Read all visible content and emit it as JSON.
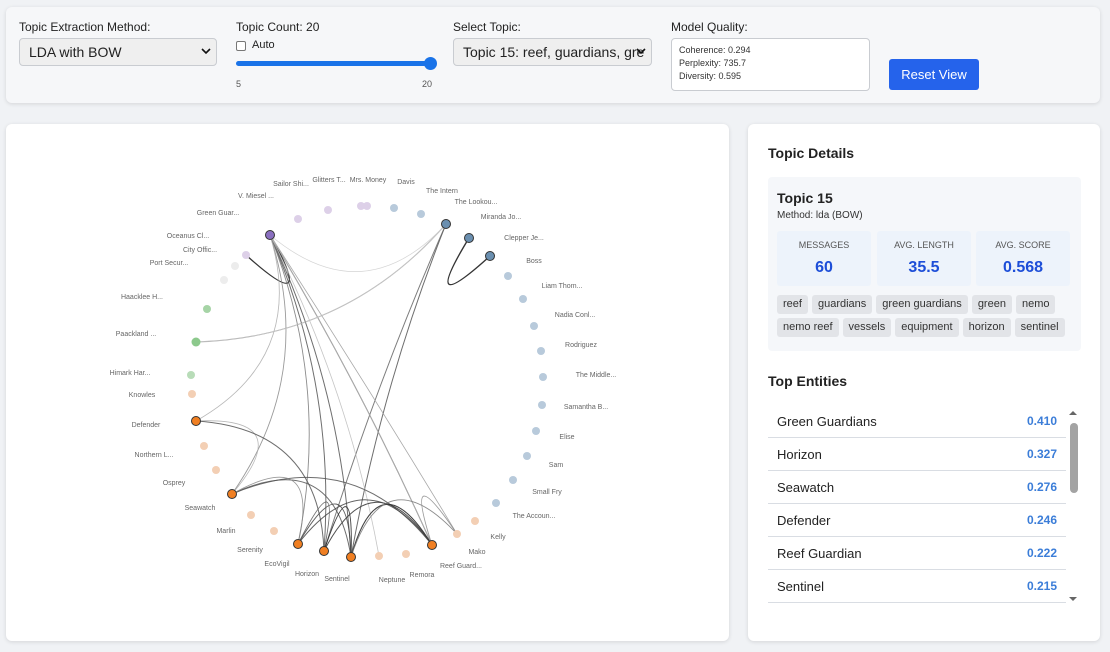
{
  "controls": {
    "method_label": "Topic Extraction Method:",
    "method_value": "LDA with BOW",
    "count_label": "Topic Count: 20",
    "auto_label": "Auto",
    "slider_min": "5",
    "slider_max": "20",
    "slider_fraction": 1.0,
    "topic_label": "Select Topic:",
    "topic_value": "Topic 15: reef, guardians, gre",
    "quality_label": "Model Quality:",
    "quality_lines": [
      "Coherence: 0.294",
      "Perplexity: 735.7",
      "Diversity: 0.595"
    ],
    "reset_label": "Reset View"
  },
  "graph": {
    "nodes": [
      {
        "label": "Davis",
        "color": "#b8cadb"
      },
      {
        "label": "The Intern",
        "color": "#b8cadb"
      },
      {
        "label": "The Lookou...",
        "color": "#6a8fb0"
      },
      {
        "label": "Miranda Jo...",
        "color": "#6a8fb0"
      },
      {
        "label": "Clepper Je...",
        "color": "#6a8fb0"
      },
      {
        "label": "Boss",
        "color": "#b8cadb"
      },
      {
        "label": "Liam Thom...",
        "color": "#b8cadb"
      },
      {
        "label": "Nadia Conl...",
        "color": "#b8cadb"
      },
      {
        "label": "Rodriguez",
        "color": "#b8cadb"
      },
      {
        "label": "The Middle...",
        "color": "#b8cadb"
      },
      {
        "label": "Samantha B...",
        "color": "#b8cadb"
      },
      {
        "label": "Elise",
        "color": "#b8cadb"
      },
      {
        "label": "Sam",
        "color": "#b8cadb"
      },
      {
        "label": "Small Fry",
        "color": "#b8cadb"
      },
      {
        "label": "The Accoun...",
        "color": "#b8cadb"
      },
      {
        "label": "Kelly",
        "color": "#f3cfb4"
      },
      {
        "label": "Mako",
        "color": "#f3cfb4"
      },
      {
        "label": "Reef Guard...",
        "color": "#f07f22"
      },
      {
        "label": "Remora",
        "color": "#f3cfb4"
      },
      {
        "label": "Neptune",
        "color": "#f3cfb4"
      },
      {
        "label": "Sentinel",
        "color": "#f07f22"
      },
      {
        "label": "Horizon",
        "color": "#f07f22"
      },
      {
        "label": "EcoVigil",
        "color": "#f07f22"
      },
      {
        "label": "Serenity",
        "color": "#f3cfb4"
      },
      {
        "label": "Marlin",
        "color": "#f3cfb4"
      },
      {
        "label": "Seawatch",
        "color": "#f07f22"
      },
      {
        "label": "Osprey",
        "color": "#f3cfb4"
      },
      {
        "label": "Northern L...",
        "color": "#f3cfb4"
      },
      {
        "label": "Defender",
        "color": "#f07f22"
      },
      {
        "label": "Knowles",
        "color": "#f3cfb4"
      },
      {
        "label": "Himark Har...",
        "color": "#b8dcb8"
      },
      {
        "label": "Paackland ...",
        "color": "#8cc98c"
      },
      {
        "label": "Haacklee H...",
        "color": "#a6d4a6"
      },
      {
        "label": "Port Secur...",
        "color": "#ededed"
      },
      {
        "label": "City Offic...",
        "color": "#ececec"
      },
      {
        "label": "Oceanus Cl...",
        "color": "#ddd0e8"
      },
      {
        "label": "Green Guar...",
        "color": "#8a6fc0"
      },
      {
        "label": "V. Miesel ...",
        "color": "#ddd0e8"
      },
      {
        "label": "Sailor Shi...",
        "color": "#ddd0e8"
      },
      {
        "label": "Glitters T...",
        "color": "#ddd0e8"
      },
      {
        "label": "Mrs. Money",
        "color": "#ddd0e8"
      }
    ]
  },
  "topic": {
    "details_title": "Topic Details",
    "name": "Topic 15",
    "method": "Method: lda (BOW)",
    "stats": [
      {
        "label": "MESSAGES",
        "value": "60"
      },
      {
        "label": "AVG. LENGTH",
        "value": "35.5"
      },
      {
        "label": "AVG. SCORE",
        "value": "0.568"
      }
    ],
    "keywords": [
      "reef",
      "guardians",
      "green guardians",
      "green",
      "nemo",
      "nemo reef",
      "vessels",
      "equipment",
      "horizon",
      "sentinel"
    ]
  },
  "entities": {
    "title": "Top Entities",
    "items": [
      {
        "name": "Green Guardians",
        "score": "0.410"
      },
      {
        "name": "Horizon",
        "score": "0.327"
      },
      {
        "name": "Seawatch",
        "score": "0.276"
      },
      {
        "name": "Defender",
        "score": "0.246"
      },
      {
        "name": "Reef Guardian",
        "score": "0.222"
      },
      {
        "name": "Sentinel",
        "score": "0.215"
      }
    ]
  }
}
